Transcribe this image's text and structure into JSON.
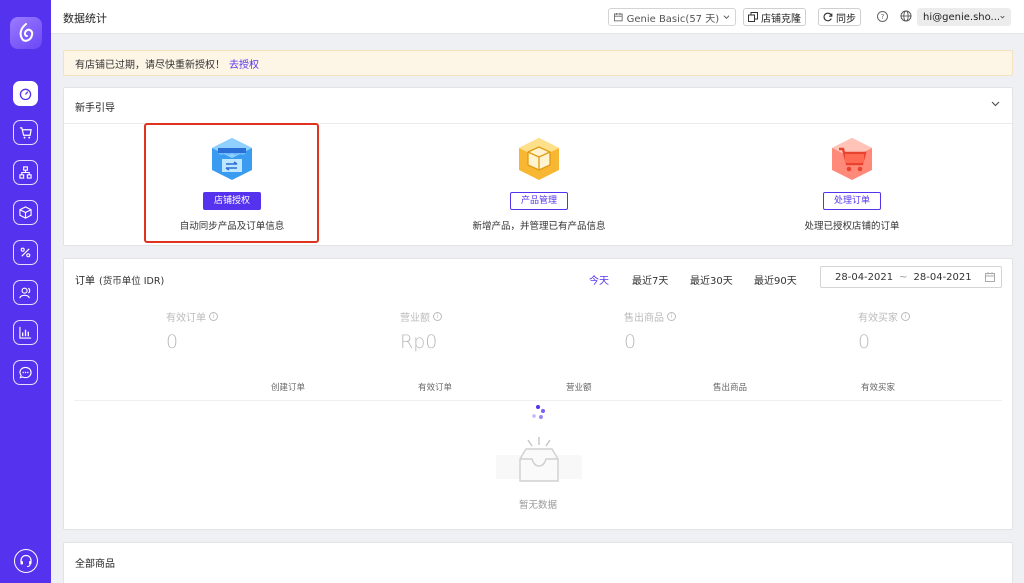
{
  "header": {
    "page_title": "数据统计",
    "plan": "Genie Basic(57 天)",
    "clone_button": "店铺克隆",
    "sync_button": "同步",
    "user_email": "hi@genie.sho..."
  },
  "alert": {
    "message": "有店铺已过期，请尽快重新授权！",
    "link": "去授权"
  },
  "guide": {
    "title": "新手引导",
    "items": [
      {
        "button": "店铺授权",
        "description": "自动同步产品及订单信息",
        "icon": "store-icon"
      },
      {
        "button": "产品管理",
        "description": "新增产品，并管理已有产品信息",
        "icon": "box-icon"
      },
      {
        "button": "处理订单",
        "description": "处理已授权店铺的订单",
        "icon": "cart-icon"
      }
    ]
  },
  "orders": {
    "title": "订单",
    "subtitle": "(货币单位 IDR)",
    "tabs": [
      "今天",
      "最近7天",
      "最近30天",
      "最近90天"
    ],
    "active_tab": 0,
    "date_start": "28-04-2021",
    "date_sep": "~",
    "date_end": "28-04-2021",
    "stats": [
      {
        "label": "有效订单",
        "value": "0"
      },
      {
        "label": "营业额",
        "value": "Rp0"
      },
      {
        "label": "售出商品",
        "value": "0"
      },
      {
        "label": "有效买家",
        "value": "0"
      }
    ],
    "legend": [
      "创建订单",
      "有效订单",
      "营业额",
      "售出商品",
      "有效买家"
    ],
    "empty_text": "暂无数据"
  },
  "products": {
    "title": "全部商品"
  },
  "colors": {
    "brand": "#5533ee",
    "highlight": "#e0331f"
  }
}
